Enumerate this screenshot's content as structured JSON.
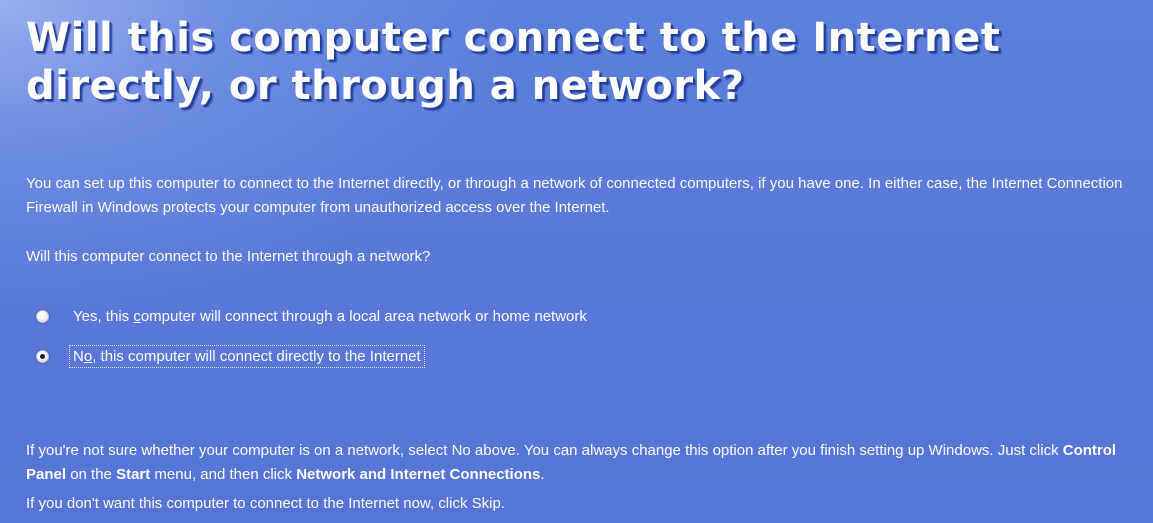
{
  "window": {
    "heading_line1": "Will this computer connect to the Internet",
    "heading_line2": "directly, or through a network?"
  },
  "intro": {
    "text": "You can set up this computer to connect to the Internet directly, or through a network of connected computers, if you have one. In either case, the Internet Connection Firewall in Windows protects your computer from unauthorized access over the Internet."
  },
  "question": {
    "text": "Will this computer connect to the Internet through a network?"
  },
  "options": [
    {
      "label_before": "Yes, this ",
      "label_accel": "c",
      "label_after": "omputer will connect through a local area network or home network",
      "selected": false
    },
    {
      "label_before": "N",
      "label_accel": "o",
      "label_after": ", this computer will connect directly to the Internet",
      "selected": true,
      "focused": true
    }
  ],
  "note": {
    "part1": "If you're not sure whether your computer is on a network, select No above. You can always change this option after you finish setting up Windows. Just click ",
    "bold1": "Control Panel",
    "part2": " on the ",
    "bold2": "Start",
    "part3": " menu, and then click  ",
    "bold3": "Network and Internet Connections",
    "part4": "."
  },
  "skip": {
    "text": "If you don't want this computer to connect to the Internet now, click Skip."
  },
  "colors": {
    "background": "#5a7edc",
    "text": "#ffffff",
    "heading_shadow": "#1f3f9c"
  }
}
